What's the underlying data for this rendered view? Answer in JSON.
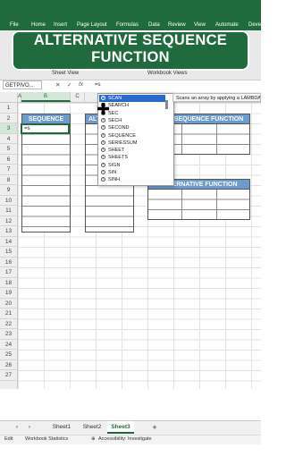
{
  "menu": {
    "items": [
      "File",
      "Home",
      "Insert",
      "Page Layout",
      "Formulas",
      "Data",
      "Review",
      "View",
      "Automate",
      "Deve"
    ]
  },
  "banner": {
    "title_line1": "ALTERNATIVE SEQUENCE",
    "title_line2": "FUNCTION"
  },
  "ribbon": {
    "group_sheet_view": "Sheet View",
    "group_workbook_views": "Workbook Views"
  },
  "formula_bar": {
    "name_box": "GETPIVO...",
    "cancel": "✕",
    "enter": "✓",
    "fx": "fx",
    "formula": "=s"
  },
  "columns": [
    "A",
    "B",
    "C",
    "D",
    "E",
    "F",
    "G",
    "H",
    "I"
  ],
  "rows": [
    "1",
    "2",
    "3",
    "4",
    "5",
    "6",
    "7",
    "8",
    "9",
    "10",
    "11",
    "12",
    "13",
    "14",
    "15",
    "16",
    "17",
    "18",
    "19",
    "20",
    "21",
    "22",
    "23",
    "24",
    "25",
    "26",
    "27"
  ],
  "tables": {
    "sequence_header": "SEQUENCE",
    "alt_header_partial": "ALT",
    "sequence_function_header": "SEQUENCE FUNCTION",
    "alternative_function_header": "ALTERNATIVE FUNCTION"
  },
  "active_cell": {
    "value": "=s"
  },
  "autocomplete": {
    "items": [
      "SCAN",
      "SEARCH",
      "SEC",
      "SECH",
      "SECOND",
      "SEQUENCE",
      "SERIESSUM",
      "SHEET",
      "SHEETS",
      "SIGN",
      "SIN",
      "SINH"
    ],
    "icon": "fx-circle-icon",
    "tooltip": "Scans an array by applying a LAMBDA"
  },
  "sheet_tabs": {
    "items": [
      "Sheet1",
      "Sheet2",
      "Sheet3"
    ],
    "active": "Sheet3",
    "add": "+"
  },
  "status_bar": {
    "mode": "Edit",
    "workbook_statistics": "Workbook Statistics",
    "accessibility": "Accessibility: Investigate"
  },
  "colors": {
    "brand_green": "#1f6b3e",
    "header_blue": "#6b9bcf",
    "highlight": "#2b68d0"
  }
}
